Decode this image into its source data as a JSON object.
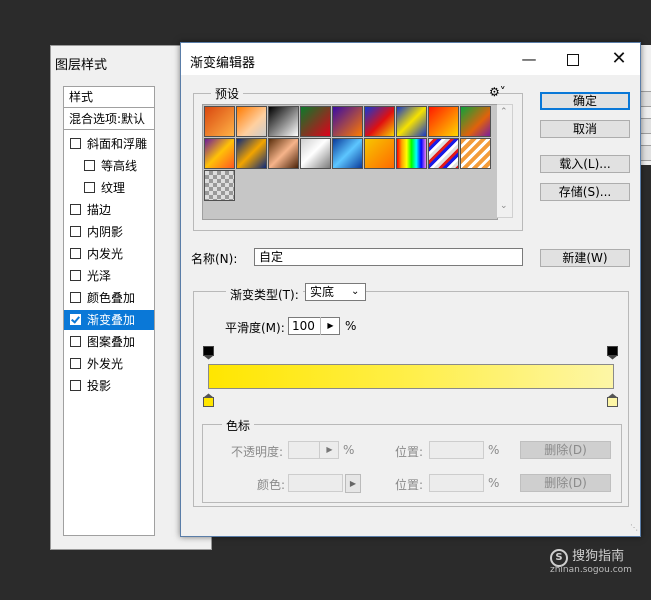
{
  "layer_style": {
    "title": "图层样式",
    "header_styles": "样式",
    "header_blend": "混合选项:默认",
    "items": [
      {
        "label": "斜面和浮雕",
        "checked": false,
        "selected": false,
        "indent": false
      },
      {
        "label": "等高线",
        "checked": false,
        "selected": false,
        "indent": true
      },
      {
        "label": "纹理",
        "checked": false,
        "selected": false,
        "indent": true
      },
      {
        "label": "描边",
        "checked": false,
        "selected": false,
        "indent": false
      },
      {
        "label": "内阴影",
        "checked": false,
        "selected": false,
        "indent": false
      },
      {
        "label": "内发光",
        "checked": false,
        "selected": false,
        "indent": false
      },
      {
        "label": "光泽",
        "checked": false,
        "selected": false,
        "indent": false
      },
      {
        "label": "颜色叠加",
        "checked": false,
        "selected": false,
        "indent": false
      },
      {
        "label": "渐变叠加",
        "checked": true,
        "selected": true,
        "indent": false
      },
      {
        "label": "图案叠加",
        "checked": false,
        "selected": false,
        "indent": false
      },
      {
        "label": "外发光",
        "checked": false,
        "selected": false,
        "indent": false
      },
      {
        "label": "投影",
        "checked": false,
        "selected": false,
        "indent": false
      }
    ]
  },
  "gradient_editor": {
    "title": "渐变编辑器",
    "presets_label": "预设",
    "buttons": {
      "ok": "确定",
      "cancel": "取消",
      "load": "载入(L)...",
      "save": "存储(S)...",
      "new": "新建(W)"
    },
    "name_label": "名称(N):",
    "name_value": "自定",
    "type_label": "渐变类型(T):",
    "type_value": "实底",
    "smooth_label": "平滑度(M):",
    "smooth_value": "100",
    "smooth_unit": "%",
    "color_stops_label": "色标",
    "opacity_label": "不透明度:",
    "percent": "%",
    "location_label": "位置:",
    "delete_label": "删除(D)",
    "color_label": "颜色:",
    "gradient_colors": [
      "#ffe600",
      "#fdf6a6"
    ],
    "presets": [
      "linear-gradient(135deg,#d9480f,#ffb347)",
      "linear-gradient(135deg,#ff7a00,#ffd0a0 60%,#ccc)",
      "linear-gradient(135deg,#000,#fff)",
      "linear-gradient(135deg,#0a7a2a,#e0001a)",
      "linear-gradient(135deg,#3a0ca3,#ff7b00)",
      "linear-gradient(135deg,#1238d6,#e01010 55%,#f7d300)",
      "linear-gradient(135deg,#1738c9,#f6e200 50%,#1738c9)",
      "linear-gradient(135deg,#ff1a00,#ffd500)",
      "linear-gradient(135deg,#0ba33a,#e0620b 60%,#7a1f9c)",
      "linear-gradient(135deg,#6a1b9a,#ffc107 50%,#ff5722)",
      "linear-gradient(135deg,#0d2a7a,#f2a400 50%,#0d2a7a)",
      "linear-gradient(135deg,#5a2e0c,#f6b48a 50%,#4a230a)",
      "linear-gradient(135deg,#cfcfcf,#fff 45%,#7b7b7b)",
      "linear-gradient(135deg,#0a3a9a,#5dc6ff 50%,#0a3a9a)",
      "linear-gradient(135deg,#f7c600,#ff6a00)",
      "linear-gradient(90deg,red,orange,yellow,lime,cyan,blue,violet)",
      "repeating-linear-gradient(135deg,#e0e0e0 0 3px,#e51a1a 3px 6px,#1a1ae5 6px 9px,#fff 9px 12px)",
      "repeating-linear-gradient(135deg,#f39c3a 0 4px,#ffffff 4px 7px)",
      "repeating-conic-gradient(#999 0 25%,#ddd 0 50%)"
    ]
  },
  "watermark": {
    "brand": "搜狗指南",
    "url": "zhinan.sogou.com"
  }
}
